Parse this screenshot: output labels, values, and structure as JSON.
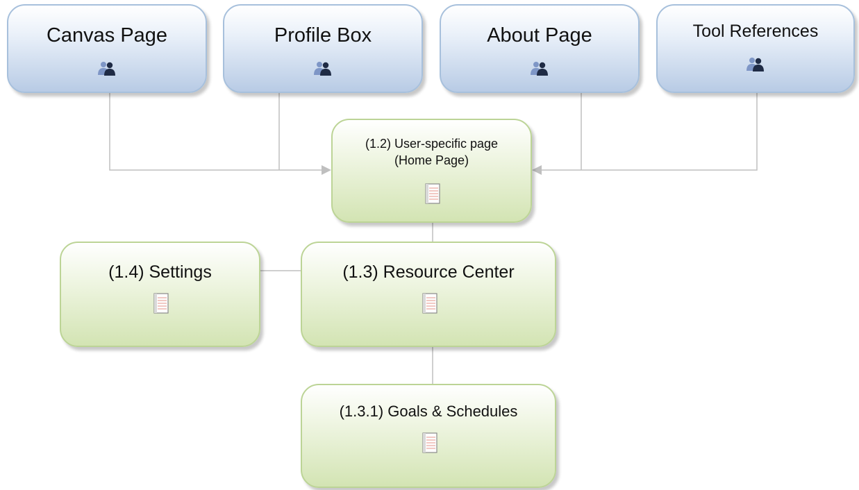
{
  "nodes": {
    "canvas_page": {
      "label": "Canvas Page",
      "icon": "users-icon"
    },
    "profile_box": {
      "label": "Profile Box",
      "icon": "users-icon"
    },
    "about_page": {
      "label": "About Page",
      "icon": "users-icon"
    },
    "tool_references": {
      "label": "Tool References",
      "icon": "users-icon"
    },
    "user_specific_page": {
      "label_line1": "(1.2) User-specific page",
      "label_line2": "(Home Page)",
      "icon": "notebook-icon"
    },
    "resource_center": {
      "label": "(1.3) Resource Center",
      "icon": "notebook-icon"
    },
    "settings": {
      "label": "(1.4) Settings",
      "icon": "notebook-icon"
    },
    "goals_schedules": {
      "label": "(1.3.1) Goals & Schedules",
      "icon": "notebook-icon"
    }
  },
  "colors": {
    "external_border": "#a7c0dc",
    "page_border": "#bcd496",
    "connector": "#bfbfbf",
    "users_icon_light": "#7e96c6",
    "users_icon_dark": "#1f2b45",
    "notebook_line": "#e8958a"
  }
}
